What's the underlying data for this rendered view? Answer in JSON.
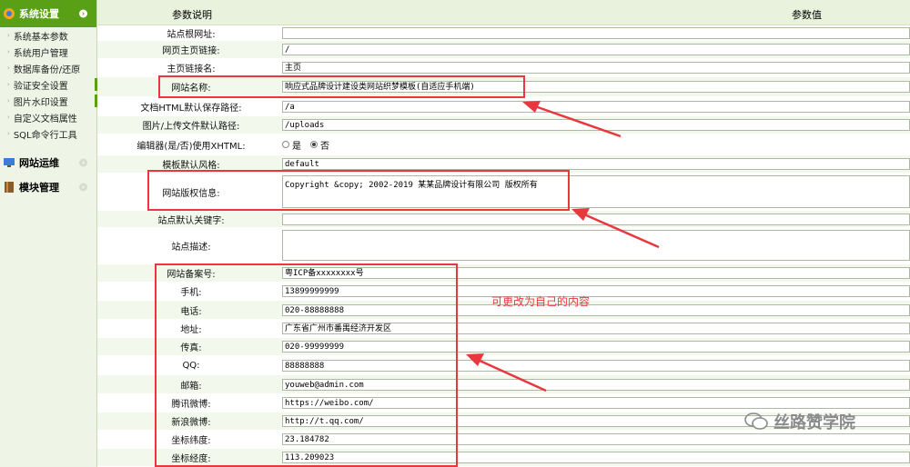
{
  "sidebar": {
    "groups": [
      {
        "label": "系统设置",
        "active": true
      },
      {
        "label": "网站运维",
        "active": false
      },
      {
        "label": "模块管理",
        "active": false
      }
    ],
    "items": [
      "系统基本参数",
      "系统用户管理",
      "数据库备份/还原",
      "验证安全设置",
      "图片水印设置",
      "自定义文档属性",
      "SQL命令行工具"
    ]
  },
  "table": {
    "header_label": "参数说明",
    "header_value": "参数值",
    "rows": [
      {
        "label": "站点根网址:",
        "value": ""
      },
      {
        "label": "网页主页链接:",
        "value": "/"
      },
      {
        "label": "主页链接名:",
        "value": "主页"
      },
      {
        "label": "网站名称:",
        "value": "响应式品牌设计建设类网站织梦模板(自适应手机端)"
      },
      {
        "label": "文档HTML默认保存路径:",
        "value": "/a"
      },
      {
        "label": "图片/上传文件默认路径:",
        "value": "/uploads"
      },
      {
        "label": "编辑器(是/否)使用XHTML:",
        "value": ""
      },
      {
        "label": "模板默认风格:",
        "value": "default"
      },
      {
        "label": "网站版权信息:",
        "value": "Copyright &copy; 2002-2019 某某品牌设计有限公司 版权所有"
      },
      {
        "label": "站点默认关键字:",
        "value": ""
      },
      {
        "label": "站点描述:",
        "value": ""
      },
      {
        "label": "网站备案号:",
        "value": "粤ICP备xxxxxxxx号"
      },
      {
        "label": "手机:",
        "value": "13899999999"
      },
      {
        "label": "电话:",
        "value": "020-88888888"
      },
      {
        "label": "地址:",
        "value": "广东省广州市番禺经济开发区"
      },
      {
        "label": "传真:",
        "value": "020-99999999"
      },
      {
        "label": "QQ:",
        "value": "88888888"
      },
      {
        "label": "邮箱:",
        "value": "youweb@admin.com"
      },
      {
        "label": "腾讯微博:",
        "value": "https://weibo.com/"
      },
      {
        "label": "新浪微博:",
        "value": "http://t.qq.com/"
      },
      {
        "label": "坐标纬度:",
        "value": "23.184782"
      },
      {
        "label": "坐标经度:",
        "value": "113.209023"
      }
    ],
    "xhtml_options": {
      "yes": "是",
      "no": "否",
      "selected": "no"
    }
  },
  "annotation": {
    "note": "可更改为自己的内容",
    "color": "#e8383d"
  },
  "watermark": "丝路赞学院"
}
